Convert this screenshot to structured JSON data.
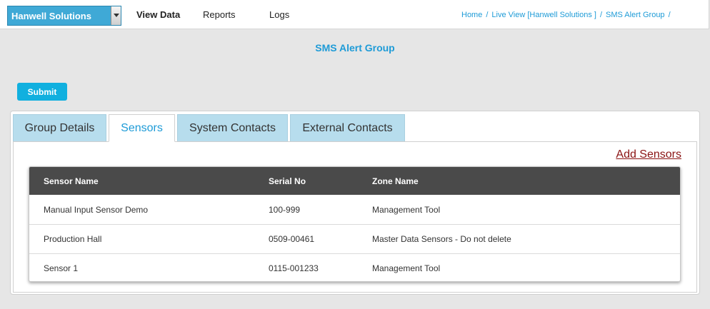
{
  "header": {
    "company_select": "Hanwell Solutions",
    "nav": [
      "View Data",
      "Reports",
      "Logs"
    ],
    "breadcrumb": [
      "Home",
      "Live View [Hanwell Solutions ]",
      "SMS Alert Group"
    ]
  },
  "page_title": "SMS Alert Group",
  "submit_label": "Submit",
  "tabs": [
    "Group Details",
    "Sensors",
    "System Contacts",
    "External Contacts"
  ],
  "active_tab": "Sensors",
  "add_sensors_label": "Add Sensors",
  "table": {
    "columns": [
      "Sensor Name",
      "Serial No",
      "Zone Name"
    ],
    "rows": [
      [
        "Manual Input Sensor Demo",
        "100-999",
        "Management Tool"
      ],
      [
        "Production Hall",
        "0509-00461",
        "Master Data Sensors - Do not delete"
      ],
      [
        "Sensor 1",
        "0115-001233",
        "Management Tool"
      ]
    ]
  },
  "colors": {
    "accent": "#1e9bd7",
    "button": "#11b0df",
    "tab_inactive": "#b7dded",
    "table_header": "#4a4a4a",
    "link_add": "#8b1414"
  }
}
